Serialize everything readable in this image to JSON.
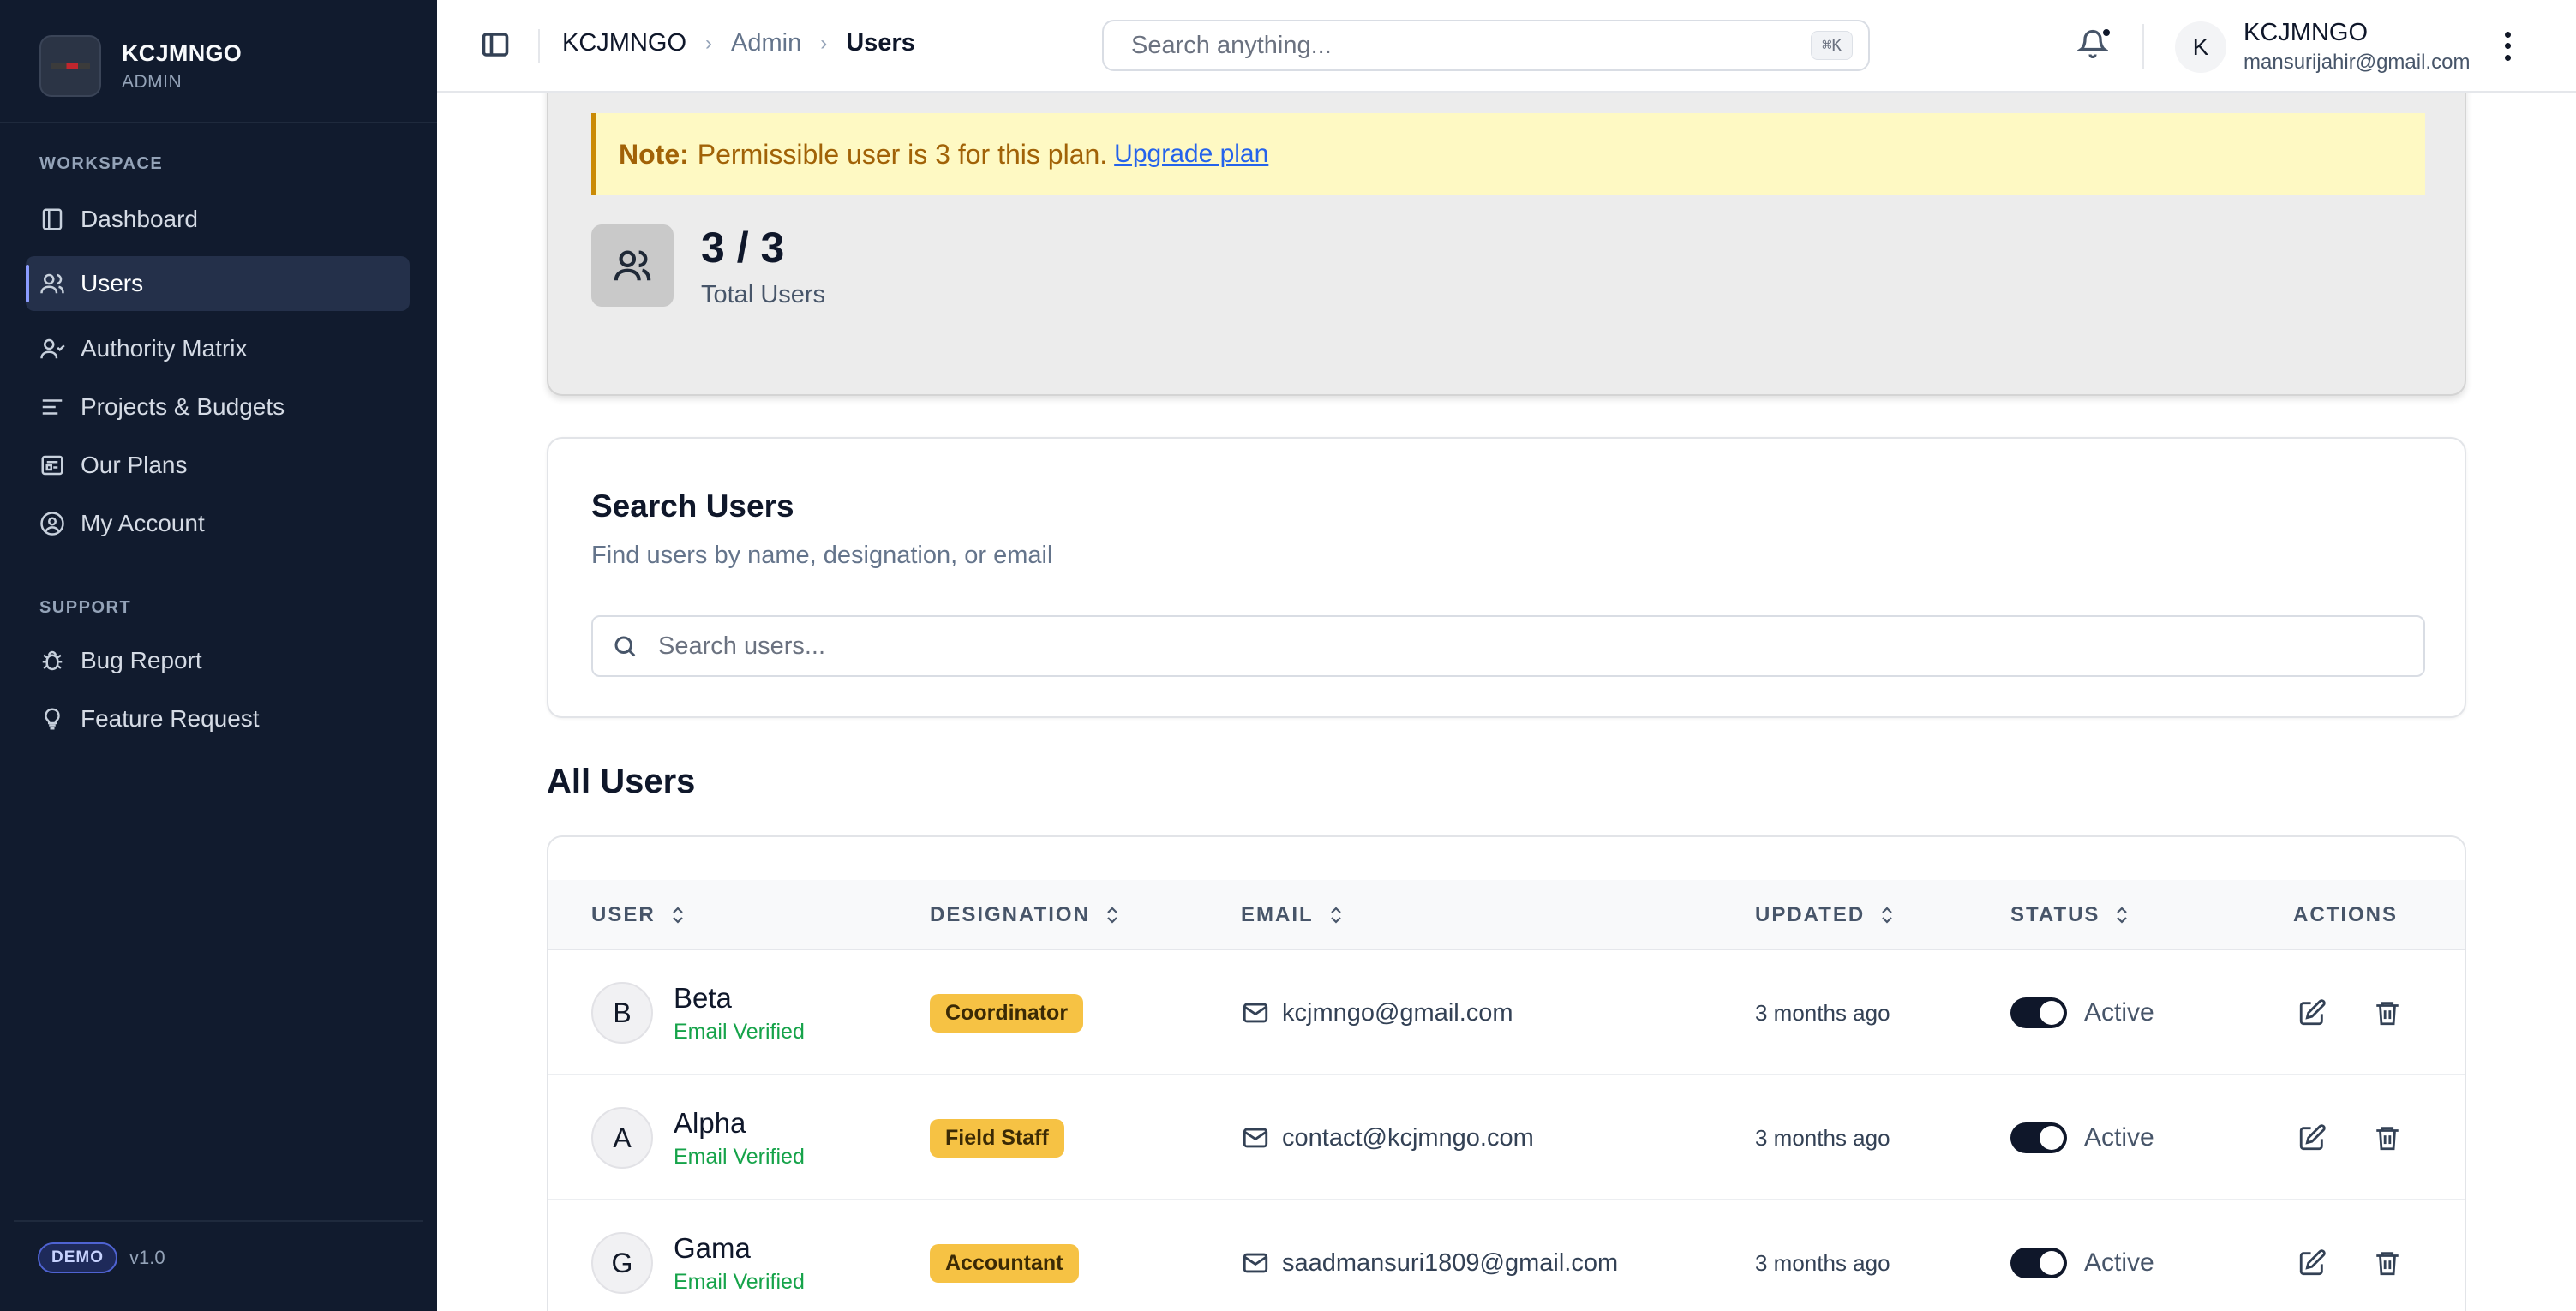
{
  "sidebar": {
    "brand_name": "KCJMNGO",
    "brand_role": "ADMIN",
    "workspace_label": "WORKSPACE",
    "support_label": "SUPPORT",
    "items": [
      {
        "label": "Dashboard",
        "icon": "dashboard-icon"
      },
      {
        "label": "Users",
        "icon": "users-icon",
        "active": true
      },
      {
        "label": "Authority Matrix",
        "icon": "authority-icon"
      },
      {
        "label": "Projects & Budgets",
        "icon": "list-icon"
      },
      {
        "label": "Our Plans",
        "icon": "plans-icon"
      },
      {
        "label": "My Account",
        "icon": "account-icon"
      }
    ],
    "support_items": [
      {
        "label": "Bug Report",
        "icon": "bug-icon"
      },
      {
        "label": "Feature Request",
        "icon": "lightbulb-icon"
      }
    ],
    "demo_badge": "DEMO",
    "version": "v1.0"
  },
  "topbar": {
    "breadcrumb": [
      "KCJMNGO",
      "Admin",
      "Users"
    ],
    "search_placeholder": "Search anything...",
    "search_shortcut": "⌘K",
    "user_initial": "K",
    "user_name": "KCJMNGO",
    "user_email": "mansurijahir@gmail.com"
  },
  "stats": {
    "note_label": "Note:",
    "note_text": "Permissible user is 3 for this plan.",
    "note_link": "Upgrade plan",
    "value": "3 / 3",
    "label": "Total Users"
  },
  "search_users": {
    "title": "Search Users",
    "subtitle": "Find users by name, designation, or email",
    "placeholder": "Search users..."
  },
  "all_users": {
    "title": "All Users",
    "columns": [
      "USER",
      "DESIGNATION",
      "EMAIL",
      "UPDATED",
      "STATUS",
      "ACTIONS"
    ],
    "rows": [
      {
        "initial": "B",
        "name": "Beta",
        "verified": "Email Verified",
        "designation": "Coordinator",
        "email": "kcjmngo@gmail.com",
        "updated": "3 months ago",
        "status": "Active",
        "enabled": true
      },
      {
        "initial": "A",
        "name": "Alpha",
        "verified": "Email Verified",
        "designation": "Field Staff",
        "email": "contact@kcjmngo.com",
        "updated": "3 months ago",
        "status": "Active",
        "enabled": true
      },
      {
        "initial": "G",
        "name": "Gama",
        "verified": "Email Verified",
        "designation": "Accountant",
        "email": "saadmansuri1809@gmail.com",
        "updated": "3 months ago",
        "status": "Active",
        "enabled": true
      }
    ]
  },
  "colors": {
    "sidebar_bg": "#111b2e",
    "badge_yellow": "#f6c244",
    "verified_green": "#16a34a",
    "note_bg": "#fef9c3"
  }
}
